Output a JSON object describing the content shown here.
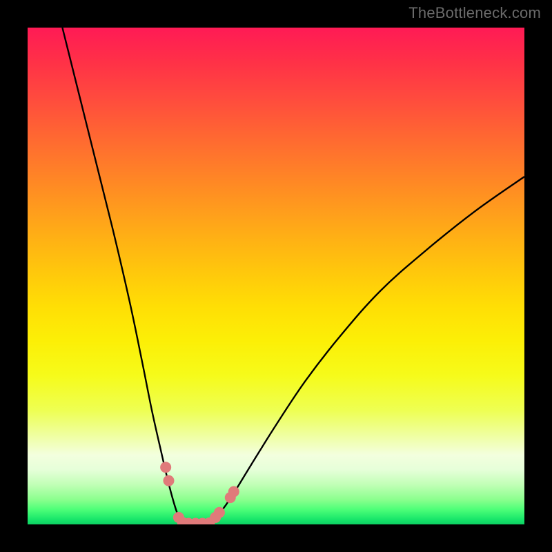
{
  "watermark": "TheBottleneck.com",
  "chart_data": {
    "type": "line",
    "title": "",
    "xlabel": "",
    "ylabel": "",
    "xlim": [
      0,
      100
    ],
    "ylim": [
      0,
      100
    ],
    "grid": false,
    "legend": false,
    "background_gradient": {
      "direction": "vertical",
      "stops": [
        {
          "pos": 0.0,
          "color": "#ff1a55"
        },
        {
          "pos": 0.3,
          "color": "#ff8a22"
        },
        {
          "pos": 0.55,
          "color": "#ffd60a"
        },
        {
          "pos": 0.8,
          "color": "#f2ff70"
        },
        {
          "pos": 0.9,
          "color": "#e6ffcf"
        },
        {
          "pos": 1.0,
          "color": "#12d264"
        }
      ]
    },
    "series": [
      {
        "name": "left-branch",
        "x": [
          7.0,
          12.0,
          17.0,
          20.5,
          23.0,
          25.0,
          26.8,
          28.2,
          29.4,
          30.4,
          31.2
        ],
        "y": [
          100.0,
          80.0,
          60.0,
          45.0,
          33.0,
          23.0,
          15.0,
          9.0,
          4.5,
          1.5,
          0.0
        ]
      },
      {
        "name": "floor-segment",
        "x": [
          31.2,
          33.0,
          35.0,
          36.8
        ],
        "y": [
          0.0,
          0.0,
          0.0,
          0.0
        ]
      },
      {
        "name": "right-branch",
        "x": [
          36.8,
          38.5,
          41.0,
          45.0,
          50.0,
          56.0,
          63.0,
          71.0,
          80.0,
          90.0,
          100.0
        ],
        "y": [
          0.0,
          2.0,
          5.5,
          12.0,
          20.0,
          29.0,
          38.0,
          47.0,
          55.0,
          63.0,
          70.0
        ]
      }
    ],
    "markers": {
      "name": "salmon-dots",
      "color": "#e07a7a",
      "points": [
        {
          "x": 27.8,
          "y": 11.5
        },
        {
          "x": 28.4,
          "y": 8.8
        },
        {
          "x": 30.4,
          "y": 1.4
        },
        {
          "x": 31.2,
          "y": 0.4
        },
        {
          "x": 32.4,
          "y": 0.2
        },
        {
          "x": 33.8,
          "y": 0.2
        },
        {
          "x": 35.2,
          "y": 0.2
        },
        {
          "x": 36.6,
          "y": 0.3
        },
        {
          "x": 37.8,
          "y": 1.4
        },
        {
          "x": 38.6,
          "y": 2.4
        },
        {
          "x": 40.8,
          "y": 5.4
        },
        {
          "x": 41.5,
          "y": 6.6
        }
      ]
    }
  }
}
